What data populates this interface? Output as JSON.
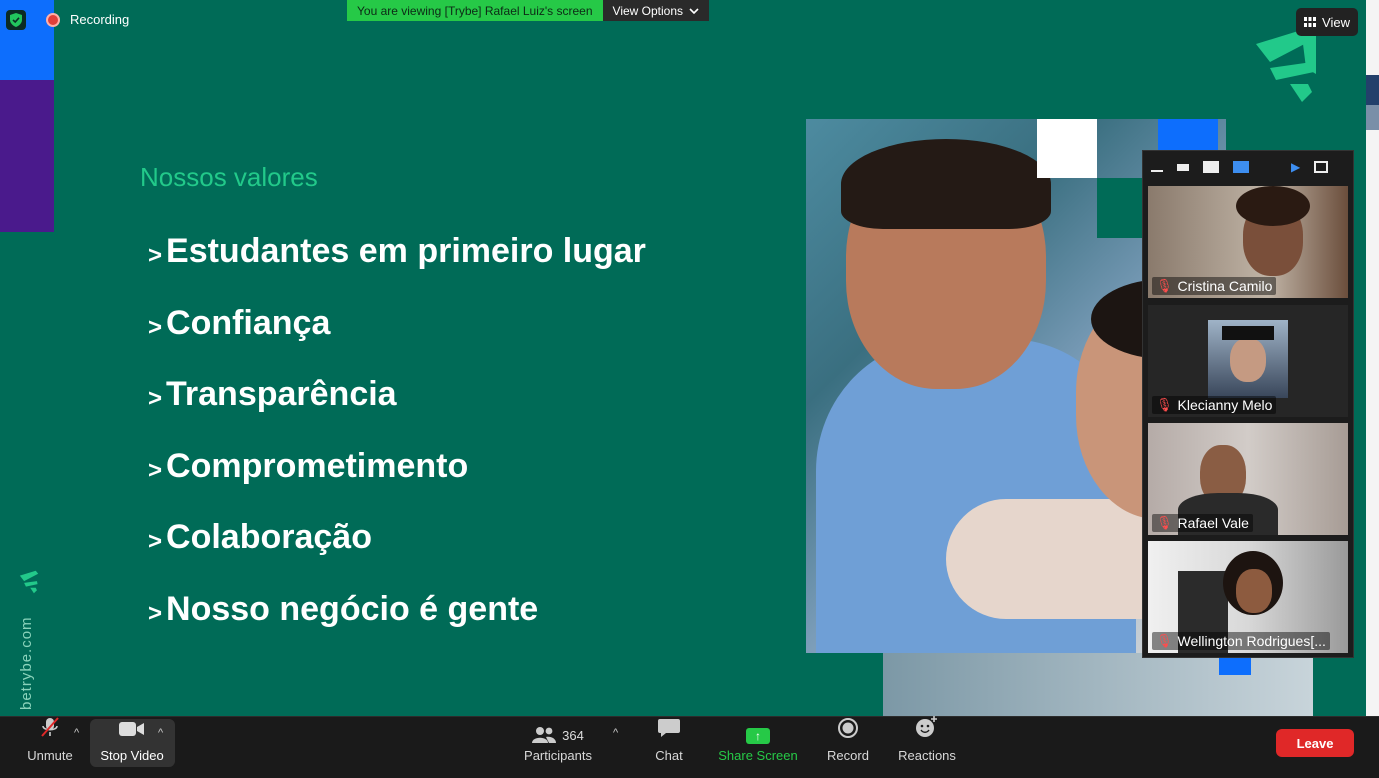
{
  "top_bar": {
    "recording_label": "Recording",
    "viewing_message": "You are viewing [Trybe] Rafael Luiz's screen",
    "view_options_label": "View Options",
    "view_button_label": "View"
  },
  "slide": {
    "title": "Nossos valores",
    "values": [
      ">Estudantes em primeiro lugar",
      ">Confiança",
      ">Transparência",
      ">Comprometimento",
      ">Colaboração",
      ">Nosso negócio é gente"
    ],
    "side_text": "betrybe.com",
    "colors": {
      "background": "#006b57",
      "accent": "#22c98a",
      "blue": "#0d6efd",
      "purple": "#4a1a8c"
    }
  },
  "gallery": {
    "participants": [
      {
        "name": "Cristina Camilo",
        "muted": true
      },
      {
        "name": "Klecianny Melo",
        "muted": true
      },
      {
        "name": "Rafael Vale",
        "muted": true
      },
      {
        "name": "Wellington Rodrigues[...",
        "muted": true
      }
    ]
  },
  "toolbar": {
    "unmute_label": "Unmute",
    "stop_video_label": "Stop Video",
    "participants_label": "Participants",
    "participants_count": "364",
    "chat_label": "Chat",
    "share_screen_label": "Share Screen",
    "record_label": "Record",
    "reactions_label": "Reactions",
    "leave_label": "Leave"
  }
}
